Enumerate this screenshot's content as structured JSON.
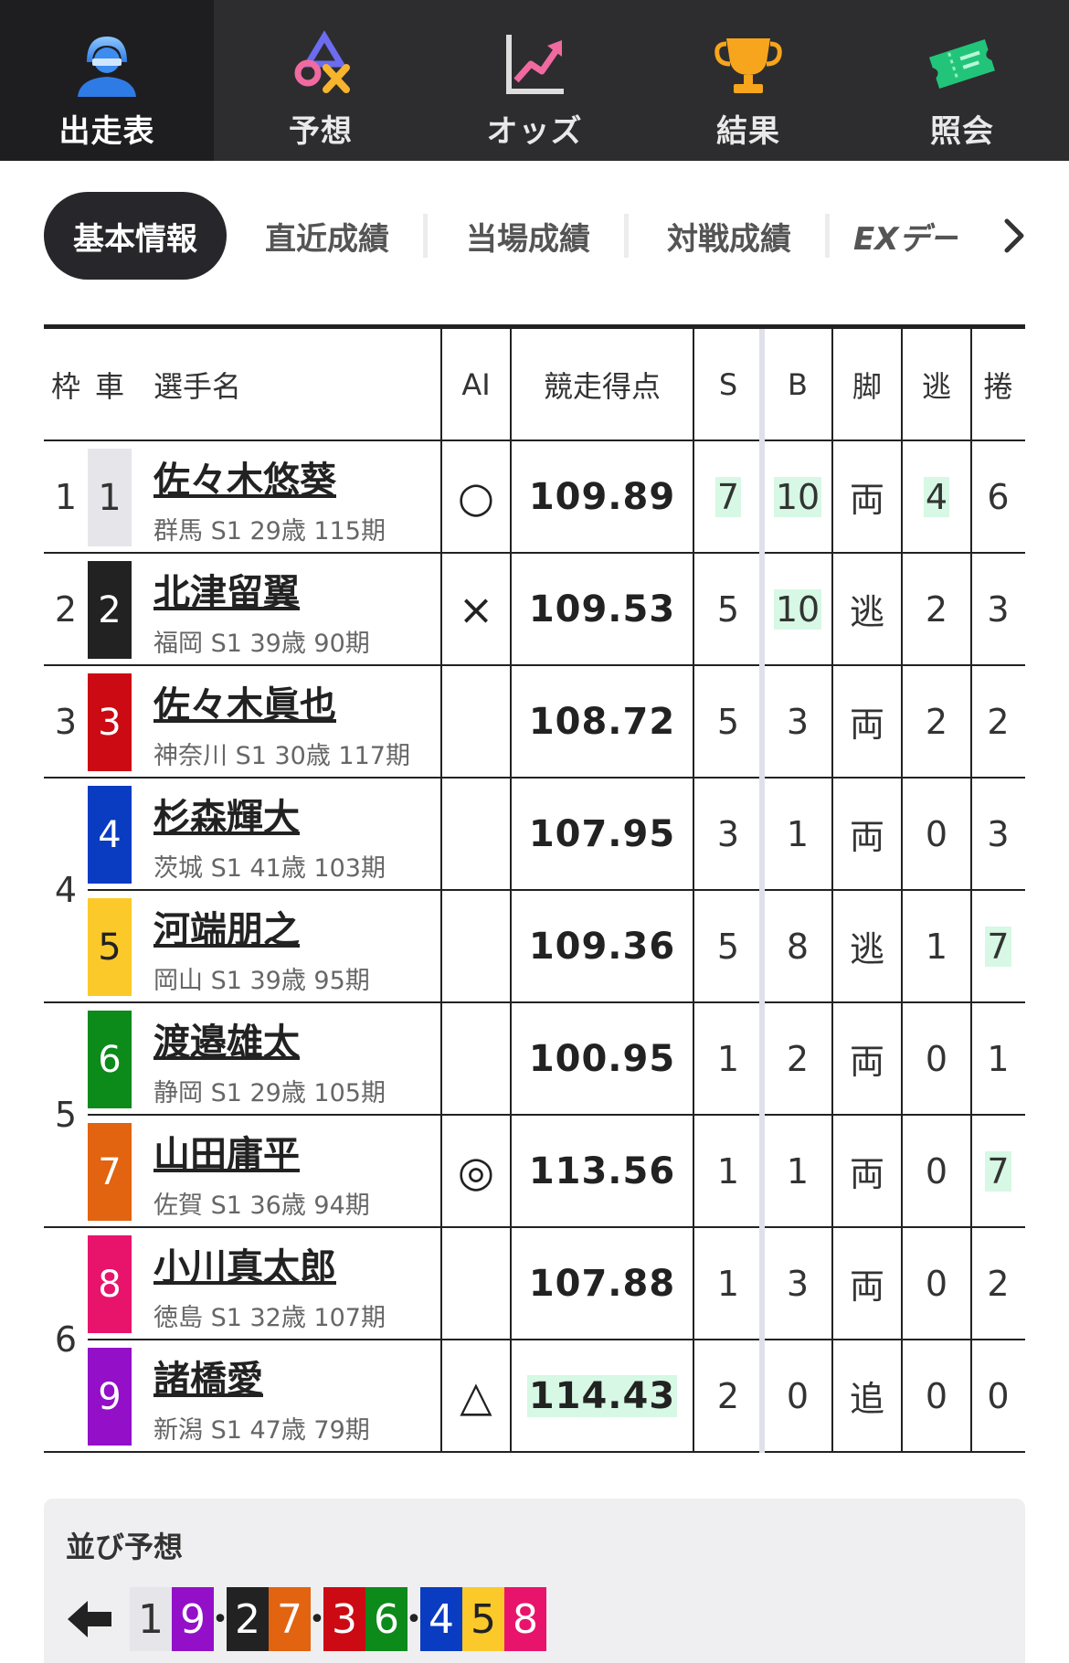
{
  "nav": [
    {
      "label": "出走表",
      "icon": "racer-icon",
      "active": true
    },
    {
      "label": "予想",
      "icon": "prediction-icon",
      "active": false
    },
    {
      "label": "オッズ",
      "icon": "odds-chart-icon",
      "active": false
    },
    {
      "label": "結果",
      "icon": "trophy-icon",
      "active": false
    },
    {
      "label": "照会",
      "icon": "ticket-icon",
      "active": false
    }
  ],
  "subtabs": [
    "基本情報",
    "直近成績",
    "当場成績",
    "対戦成績",
    "EXデー"
  ],
  "table_headers": {
    "frame": "枠",
    "car": "車",
    "name": "選手名",
    "ai": "AI",
    "score": "競走得点",
    "s": "S",
    "b": "B",
    "leg": "脚",
    "nige": "逃",
    "makuri": "捲"
  },
  "frame_labels": [
    "1",
    "2",
    "3",
    "4",
    "5",
    "6"
  ],
  "racers": [
    {
      "car": "1",
      "name": "佐々木悠葵",
      "info": "群馬 S1 29歳 115期",
      "ai": "○",
      "score": "109.89",
      "s": "7",
      "b": "10",
      "leg": "両",
      "nige": "4",
      "makuri": "6",
      "hl": [
        "s",
        "b",
        "nige"
      ]
    },
    {
      "car": "2",
      "name": "北津留翼",
      "info": "福岡 S1 39歳 90期",
      "ai": "×",
      "score": "109.53",
      "s": "5",
      "b": "10",
      "leg": "逃",
      "nige": "2",
      "makuri": "3",
      "hl": [
        "b"
      ]
    },
    {
      "car": "3",
      "name": "佐々木眞也",
      "info": "神奈川 S1 30歳 117期",
      "ai": "",
      "score": "108.72",
      "s": "5",
      "b": "3",
      "leg": "両",
      "nige": "2",
      "makuri": "2",
      "hl": []
    },
    {
      "car": "4",
      "name": "杉森輝大",
      "info": "茨城 S1 41歳 103期",
      "ai": "",
      "score": "107.95",
      "s": "3",
      "b": "1",
      "leg": "両",
      "nige": "0",
      "makuri": "3",
      "hl": []
    },
    {
      "car": "5",
      "name": "河端朋之",
      "info": "岡山 S1 39歳 95期",
      "ai": "",
      "score": "109.36",
      "s": "5",
      "b": "8",
      "leg": "逃",
      "nige": "1",
      "makuri": "7",
      "hl": [
        "makuri"
      ]
    },
    {
      "car": "6",
      "name": "渡邉雄太",
      "info": "静岡 S1 29歳 105期",
      "ai": "",
      "score": "100.95",
      "s": "1",
      "b": "2",
      "leg": "両",
      "nige": "0",
      "makuri": "1",
      "hl": []
    },
    {
      "car": "7",
      "name": "山田庸平",
      "info": "佐賀 S1 36歳 94期",
      "ai": "◎",
      "score": "113.56",
      "s": "1",
      "b": "1",
      "leg": "両",
      "nige": "0",
      "makuri": "7",
      "hl": [
        "makuri"
      ]
    },
    {
      "car": "8",
      "name": "小川真太郎",
      "info": "徳島 S1 32歳 107期",
      "ai": "",
      "score": "107.88",
      "s": "1",
      "b": "3",
      "leg": "両",
      "nige": "0",
      "makuri": "2",
      "hl": []
    },
    {
      "car": "9",
      "name": "諸橋愛",
      "info": "新潟 S1 47歳 79期",
      "ai": "△",
      "score": "114.43",
      "s": "2",
      "b": "0",
      "leg": "追",
      "nige": "0",
      "makuri": "0",
      "hl": [
        "score"
      ]
    }
  ],
  "car_colors": {
    "1": {
      "bg": "#e6e6ea",
      "fg": "#333333"
    },
    "2": {
      "bg": "#222222",
      "fg": "#ffffff"
    },
    "3": {
      "bg": "#cc0a14",
      "fg": "#ffffff"
    },
    "4": {
      "bg": "#0a3cc2",
      "fg": "#ffffff"
    },
    "5": {
      "bg": "#fcc92a",
      "fg": "#222222"
    },
    "6": {
      "bg": "#0c8a1a",
      "fg": "#ffffff"
    },
    "7": {
      "bg": "#e26310",
      "fg": "#ffffff"
    },
    "8": {
      "bg": "#e8146c",
      "fg": "#ffffff"
    },
    "9": {
      "bg": "#9310c8",
      "fg": "#ffffff"
    }
  },
  "highlight_color": "#d6f8e4",
  "lineup": {
    "title": "並び予想",
    "groups": [
      [
        "1",
        "9"
      ],
      [
        "2",
        "7"
      ],
      [
        "3",
        "6"
      ],
      [
        "4",
        "5",
        "8"
      ]
    ]
  }
}
